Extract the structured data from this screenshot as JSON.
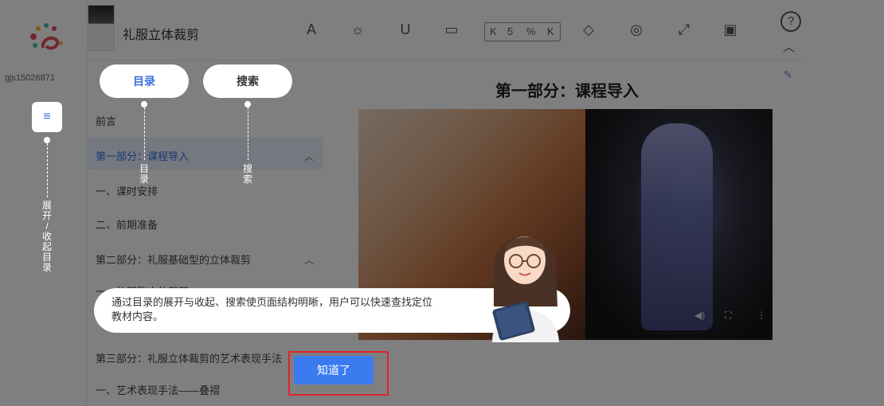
{
  "sidebar": {
    "username": "gjs15026871",
    "toc_toggle_icon": "menu-collapse-icon"
  },
  "header": {
    "book_title": "礼服立体裁剪",
    "zoom": {
      "k_left": "K",
      "value": "5",
      "unit": "%",
      "k_right": "K"
    },
    "help_label": "?"
  },
  "toc": {
    "items": [
      {
        "label": "前言",
        "active": false
      },
      {
        "label": "第一部分：课程导入",
        "active": true
      },
      {
        "label": "一、课时安排",
        "active": false
      },
      {
        "label": "二、前期准备",
        "active": false
      },
      {
        "label": "第二部分：礼服基础型的立体裁剪",
        "active": false
      },
      {
        "label": "一、礼服胸衣的裁剪",
        "active": false
      },
      {
        "label": "第三部分：礼服立体裁剪的艺术表现手法",
        "active": false
      },
      {
        "label": "一、艺术表现手法——叠褶",
        "active": false
      }
    ]
  },
  "content": {
    "section_title": "第一部分：课程导入"
  },
  "guide": {
    "toc_pill": "目录",
    "search_pill": "搜索",
    "toc_vertical": [
      "目",
      "录"
    ],
    "search_vertical": [
      "搜",
      "索"
    ],
    "rail_vertical": [
      "展",
      "开",
      "/",
      "收",
      "起",
      "目",
      "录"
    ],
    "message_line1": "通过目录的展开与收起、搜索使页面结构明晰，用户可以快速查找定位",
    "message_line2": "教材内容。",
    "confirm_label": "知道了"
  },
  "colors": {
    "accent": "#3b6fe0",
    "highlight_red": "#e0242a",
    "mask": "rgba(0,0,0,0.5)"
  }
}
